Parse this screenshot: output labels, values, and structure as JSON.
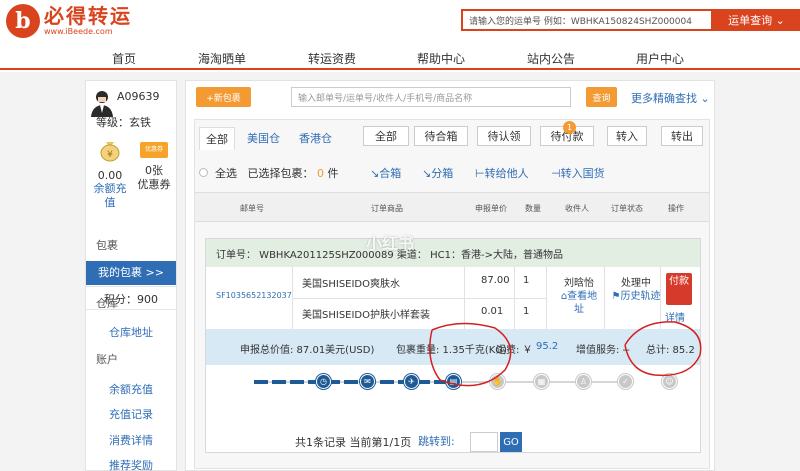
{
  "header": {
    "logo_mark": "b",
    "brand": "必得转运",
    "url": "www.iBeede.com",
    "search_placeholder": "请输入您的运单号 例如：WBHKA150824SHZ000004",
    "search_btn": "运单查询 ⌄"
  },
  "nav": [
    "首页",
    "海淘晒单",
    "转运资费",
    "帮助中心",
    "站内公告",
    "用户中心"
  ],
  "user": {
    "id": "A09639",
    "level": "等级：玄铁",
    "balance": "0.00",
    "balance_label": "余额充值",
    "coupon_icon": "优惠券",
    "coupons": "0张",
    "coupon_label": "优惠券",
    "points": "积分：900"
  },
  "sidebar": {
    "sec1": "包裹",
    "my_parcels": "我的包裹 >>",
    "sec2": "仓库",
    "warehouse_addr": "仓库地址",
    "sec3": "账户",
    "items": [
      "余额充值",
      "充值记录",
      "消费详情",
      "推荐奖励"
    ]
  },
  "toolbar": {
    "new_parcel": "+新包裹",
    "search_placeholder": "输入邮单号/运单号/收件人/手机号/商品名称",
    "query": "查询",
    "advanced": "更多精确查找 ⌄"
  },
  "tabs": [
    "全部",
    "美国仓",
    "香港仓"
  ],
  "status_buttons": [
    "全部",
    "待合箱",
    "待认领",
    "待付款",
    "转入",
    "转出"
  ],
  "badge": "1",
  "select": {
    "all": "全选",
    "selected": "已选择包裹：",
    "count": "0",
    "unit": "件"
  },
  "actions": [
    "↘合箱",
    "↘分箱",
    "⊢转给他人",
    "⊣转入国货"
  ],
  "table_headers": [
    "邮单号",
    "订单商品",
    "申报单价",
    "数量",
    "收件人",
    "订单状态",
    "操作"
  ],
  "order": {
    "header": "订单号：  WBHKA201125SHZ000089   渠道：  HC1：香港->大陆，普通物品",
    "tracking": "SF1035652132037",
    "items": [
      {
        "name": "美国SHISEIDO爽肤水",
        "price": "87.00",
        "qty": "1"
      },
      {
        "name": "美国SHISEIDO护肤小样套装",
        "price": "0.01",
        "qty": "1"
      }
    ],
    "recipient": "刘晗怡",
    "view_addr": "查看地址",
    "status": "处理中",
    "history": "历史轨迹",
    "pay": "付款",
    "detail": "详情",
    "declared": "申报总价值: 87.01美元(USD)",
    "weight": "包裹重量: 1.35千克(KG)",
    "fee_label": "运费: ￥",
    "fee_value": "95.2",
    "service": "增值服务: --",
    "total": "总计: 85.2"
  },
  "pager": {
    "summary": "共1条记录 当前第1/1页",
    "jump": "跳转到:",
    "go": "GO"
  },
  "watermark": "小红书"
}
